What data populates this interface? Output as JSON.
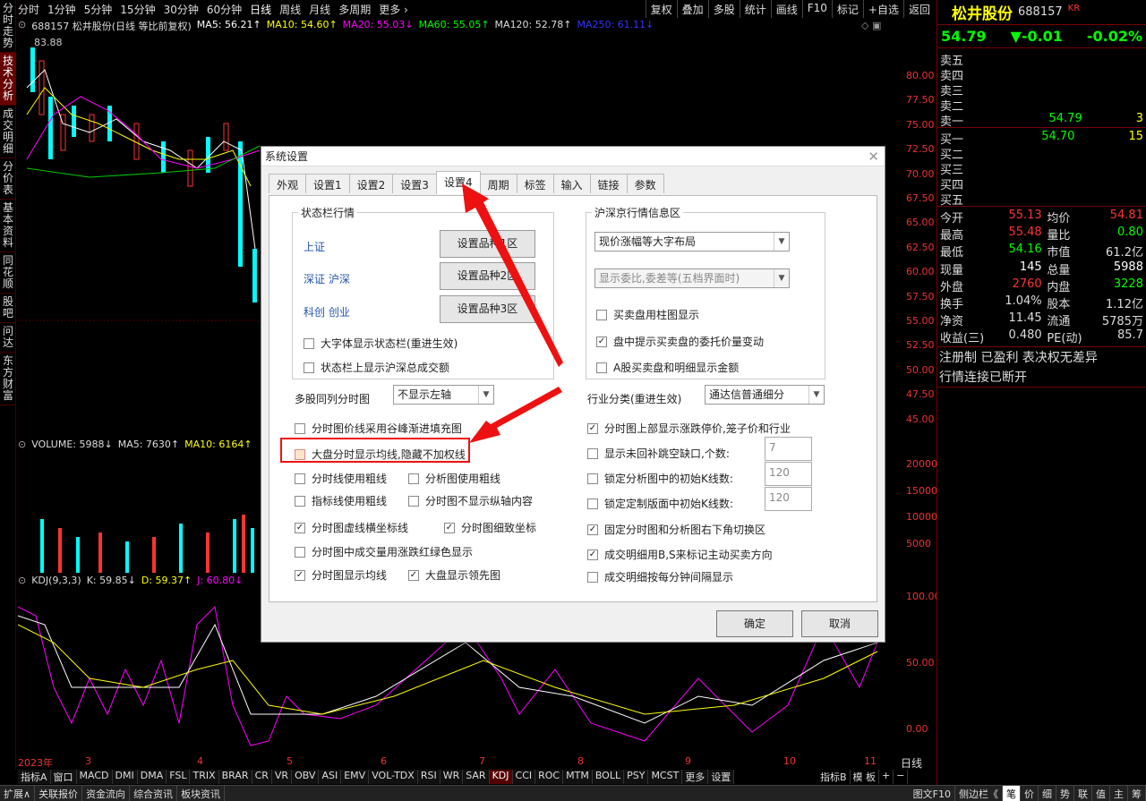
{
  "left_tabs": [
    "分时走势",
    "技术分析",
    "成交明细",
    "分价表",
    "基本资料",
    "同花顺",
    "股吧",
    "问达",
    "东方财富"
  ],
  "top_periods": [
    "分时",
    "1分钟",
    "5分钟",
    "15分钟",
    "30分钟",
    "60分钟",
    "日线",
    "周线",
    "月线",
    "多周期",
    "更多 ›"
  ],
  "top_right_buttons": [
    "复权",
    "叠加",
    "多股",
    "统计",
    "画线",
    "F10",
    "标记",
    "+自选",
    "返回"
  ],
  "chart": {
    "title": "688157 松井股份(日线 等比前复权)",
    "ma5": "MA5: 56.21↑",
    "ma10": "MA10: 54.60↑",
    "ma20": "MA20: 55.03↓",
    "ma60": "MA60: 55.05↑",
    "ma120": "MA120: 52.78↑",
    "ma250": "MA250: 61.11↓",
    "high_mark": "83.88",
    "price_ticks": [
      "80.00",
      "77.50",
      "75.00",
      "72.50",
      "70.00",
      "67.50",
      "65.00",
      "62.50",
      "60.00",
      "57.50",
      "55.00",
      "52.50",
      "50.00",
      "47.50",
      "45.00"
    ],
    "volume_title": "VOLUME: 5988↓",
    "vol_ma5": "MA5: 7630↑",
    "vol_ma10": "MA10: 6164↑",
    "volume_ticks": [
      "20000",
      "15000",
      "10000",
      "5000"
    ],
    "kdj_title": "KDJ(9,3,3)",
    "kdj_k": "K: 59.85↓",
    "kdj_d": "D: 59.37↑",
    "kdj_j": "J: 60.80↓",
    "kdj_ticks": [
      "100.00",
      "50.00",
      "0.00"
    ],
    "x_labels": [
      "2023年",
      "3",
      "4",
      "5",
      "6",
      "7",
      "8",
      "9",
      "10",
      "11"
    ],
    "period_label": "日线"
  },
  "indicator_tabs": [
    "指标A",
    "窗口",
    "MACD",
    "DMI",
    "DMA",
    "FSL",
    "TRIX",
    "BRAR",
    "CR",
    "VR",
    "OBV",
    "ASI",
    "EMV",
    "VOL-TDX",
    "RSI",
    "WR",
    "SAR",
    "KDJ",
    "CCI",
    "ROC",
    "MTM",
    "BOLL",
    "PSY",
    "MCST",
    "更多",
    "设置"
  ],
  "indicator_right": [
    "指标B",
    "模 板",
    "+",
    "−"
  ],
  "bottom_bar": [
    "扩展∧",
    "关联报价",
    "资金流向",
    "综合资讯",
    "板块资讯"
  ],
  "bottom_right": [
    "图文F10",
    "侧边栏《",
    "笔",
    "价",
    "细",
    "势",
    "联",
    "值",
    "主",
    "筹"
  ],
  "quote": {
    "name": "松井股份",
    "code": "688157",
    "tag": "KR",
    "price": "54.79",
    "change": "▼-0.01",
    "pct": "-0.02%",
    "asks": [
      [
        "卖五",
        "",
        ""
      ],
      [
        "卖四",
        "",
        ""
      ],
      [
        "卖三",
        "",
        ""
      ],
      [
        "卖二",
        "",
        ""
      ],
      [
        "卖一",
        "54.79",
        "3"
      ]
    ],
    "bids": [
      [
        "买一",
        "54.70",
        "15"
      ],
      [
        "买二",
        "",
        ""
      ],
      [
        "买三",
        "",
        ""
      ],
      [
        "买四",
        "",
        ""
      ],
      [
        "买五",
        "",
        ""
      ]
    ],
    "stats": [
      [
        "今开",
        "55.13",
        "均价",
        "54.81"
      ],
      [
        "最高",
        "55.48",
        "量比",
        "0.80"
      ],
      [
        "最低",
        "54.16",
        "市值",
        "61.2亿"
      ],
      [
        "现量",
        "145",
        "总量",
        "5988"
      ],
      [
        "外盘",
        "2760",
        "内盘",
        "3228"
      ],
      [
        "换手",
        "1.04%",
        "股本",
        "1.12亿"
      ],
      [
        "净资",
        "11.45",
        "流通",
        "5785万"
      ],
      [
        "收益(三)",
        "0.480",
        "PE(动)",
        "85.7"
      ]
    ],
    "note1": "注册制 已盈利 表决权无差异",
    "note2": "行情连接已断开"
  },
  "dialog": {
    "title": "系统设置",
    "tabs": [
      "外观",
      "设置1",
      "设置2",
      "设置3",
      "设置4",
      "周期",
      "标签",
      "输入",
      "链接",
      "参数"
    ],
    "status_group": "状态栏行情",
    "links": [
      "上证",
      "深证 沪深",
      "科创 创业"
    ],
    "set_buttons": [
      "设置品种1区",
      "设置品种2区",
      "设置品种3区"
    ],
    "status_checks": [
      "大字体显示状态栏(重进生效)",
      "状态栏上显示沪深总成交额"
    ],
    "hs_group": "沪深京行情信息区",
    "hs_select1": "现价涨幅等大字布局",
    "hs_select2": "显示委比,委差等(五档界面时)",
    "hs_checks": [
      "买卖盘用柱图显示",
      "盘中提示买卖盘的委托价量变动",
      "A股买卖盘和明细显示金额"
    ],
    "multi_label": "多股同列分时图",
    "multi_select": "不显示左轴",
    "industry_label": "行业分类(重进生效)",
    "industry_select": "通达信普通细分",
    "left_checks": [
      "分时图价线采用谷峰渐进填充图",
      "大盘分时显示均线,隐藏不加权线",
      "分时线使用粗线",
      "指标线使用粗线",
      "分时图虚线横坐标线",
      "分时图中成交量用涨跌红绿色显示",
      "分时图显示均线"
    ],
    "mid_checks": [
      "分析图使用粗线",
      "分时图不显示纵轴内容",
      "分时图细致坐标",
      "大盘显示领先图"
    ],
    "right_checks": [
      "分时图上部显示涨跌停价,笼子价和行业",
      "显示未回补跳空缺口,个数:",
      "锁定分析图中的初始K线数:",
      "锁定定制版面中初始K线数:",
      "固定分时图和分析图右下角切换区",
      "成交明细用B,S来标记主动买卖方向",
      "成交明细按每分钟间隔显示"
    ],
    "num_values": [
      "7",
      "120",
      "120"
    ],
    "ok": "确定",
    "cancel": "取消"
  }
}
